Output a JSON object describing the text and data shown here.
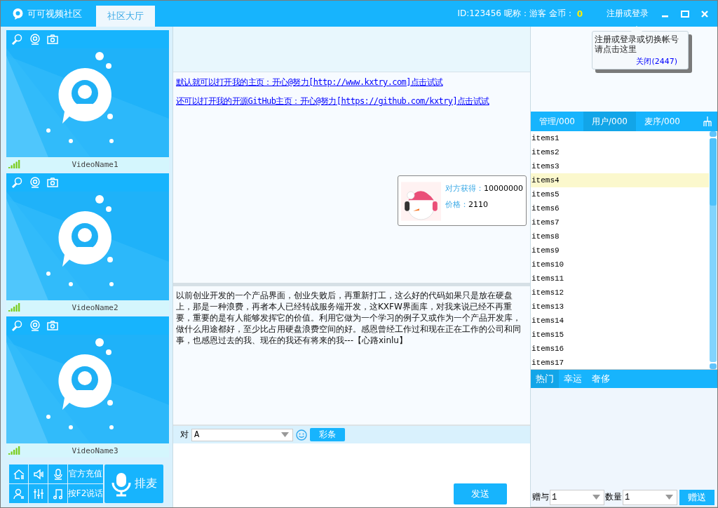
{
  "window": {
    "app_name": "可可视频社区",
    "tabs": [
      {
        "label": "社区大厅",
        "selected": true
      }
    ],
    "user_info": "ID:123456 呢称：游客 金币：",
    "coins": "0",
    "login_link": "注册或登录"
  },
  "tooltip": {
    "lines": [
      "注册或登录或切换帐号",
      "请点击这里"
    ],
    "close": "关闭(2447)"
  },
  "videos": [
    {
      "name": "VideoName1"
    },
    {
      "name": "VideoName2"
    },
    {
      "name": "VideoName3"
    }
  ],
  "controls": {
    "recharge": "官方充值",
    "push_to_talk": "按F2说话",
    "queue": "排麦"
  },
  "chat": {
    "links": [
      "默认就可以打开我的主页：开心@努力[http://www.kxtry.com]点击试试",
      "还可以打开我的开源GitHub主页：开心@努力[https://github.com/kxtry]点击试试"
    ],
    "gift_popup": {
      "received_label": "对方获得：",
      "received": "10000000",
      "price_label": "价格：",
      "price": "2110"
    },
    "notice": "以前创业开发的一个产品界面，创业失败后，再重新打工，这么好的代码如果只是放在硬盘上，那是一种浪费，再者本人已经转战服务端开发，这KXFW界面库，对我来说已经不再重要，重要的是有人能够发挥它的价值。利用它做为一个学习的例子又或作为一个产品开发库，做什么用途都好，至少比占用硬盘浪费空间的好。感恩曾经工作过和现在正在工作的公司和同事，也感恩过去的我、现在的我还有将来的我---【心路xinlu】",
    "target_label": "对",
    "target": "A",
    "color_bar": "彩条",
    "send": "发送"
  },
  "user_tabs": [
    {
      "label": "管理/000",
      "selected": false
    },
    {
      "label": "用户/000",
      "selected": true
    },
    {
      "label": "麦序/000",
      "selected": false
    }
  ],
  "users": [
    {
      "name": "items1",
      "selected": false
    },
    {
      "name": "items2",
      "selected": false
    },
    {
      "name": "items3",
      "selected": false
    },
    {
      "name": "items4",
      "selected": true
    },
    {
      "name": "items5",
      "selected": false
    },
    {
      "name": "items6",
      "selected": false
    },
    {
      "name": "items7",
      "selected": false
    },
    {
      "name": "items8",
      "selected": false
    },
    {
      "name": "items9",
      "selected": false
    },
    {
      "name": "items10",
      "selected": false
    },
    {
      "name": "items11",
      "selected": false
    },
    {
      "name": "items12",
      "selected": false
    },
    {
      "name": "items13",
      "selected": false
    },
    {
      "name": "items14",
      "selected": false
    },
    {
      "name": "items15",
      "selected": false
    },
    {
      "name": "items16",
      "selected": false
    },
    {
      "name": "items17",
      "selected": false
    }
  ],
  "gift_tabs": [
    {
      "label": "热门",
      "selected": true
    },
    {
      "label": "幸运",
      "selected": false
    },
    {
      "label": "奢侈",
      "selected": false
    }
  ],
  "gift_form": {
    "to_label": "赠与",
    "to": "1",
    "count_label": "数量",
    "count": "1",
    "give": "赠送"
  }
}
